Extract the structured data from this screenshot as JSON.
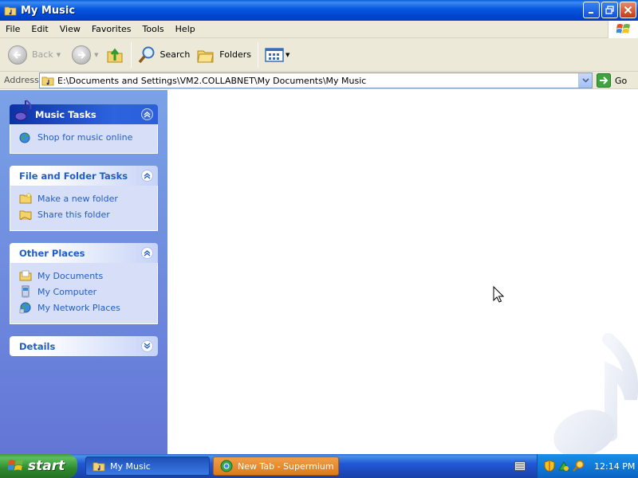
{
  "window": {
    "title": "My Music"
  },
  "menu": {
    "items": [
      "File",
      "Edit",
      "View",
      "Favorites",
      "Tools",
      "Help"
    ]
  },
  "toolbar": {
    "back_label": "Back",
    "search_label": "Search",
    "folders_label": "Folders"
  },
  "address": {
    "label": "Address",
    "value": "E:\\Documents and Settings\\VM2.COLLABNET\\My Documents\\My Music",
    "go_label": "Go"
  },
  "sidebar": {
    "music_tasks": {
      "title": "Music Tasks",
      "items": [
        "Shop for music online"
      ]
    },
    "file_folder_tasks": {
      "title": "File and Folder Tasks",
      "items": [
        "Make a new folder",
        "Share this folder"
      ]
    },
    "other_places": {
      "title": "Other Places",
      "items": [
        "My Documents",
        "My Computer",
        "My Network Places"
      ]
    },
    "details": {
      "title": "Details"
    }
  },
  "taskbar": {
    "start_label": "start",
    "buttons": [
      "My Music",
      "New Tab - Supermium"
    ],
    "clock": "12:14 PM"
  },
  "colors": {
    "titlebar_blue": "#0a5ae0",
    "sidebar_link": "#215dc6",
    "taskbar_blue": "#2157d7",
    "start_green": "#2f8a2f",
    "active_task_orange": "#dc7a18"
  }
}
